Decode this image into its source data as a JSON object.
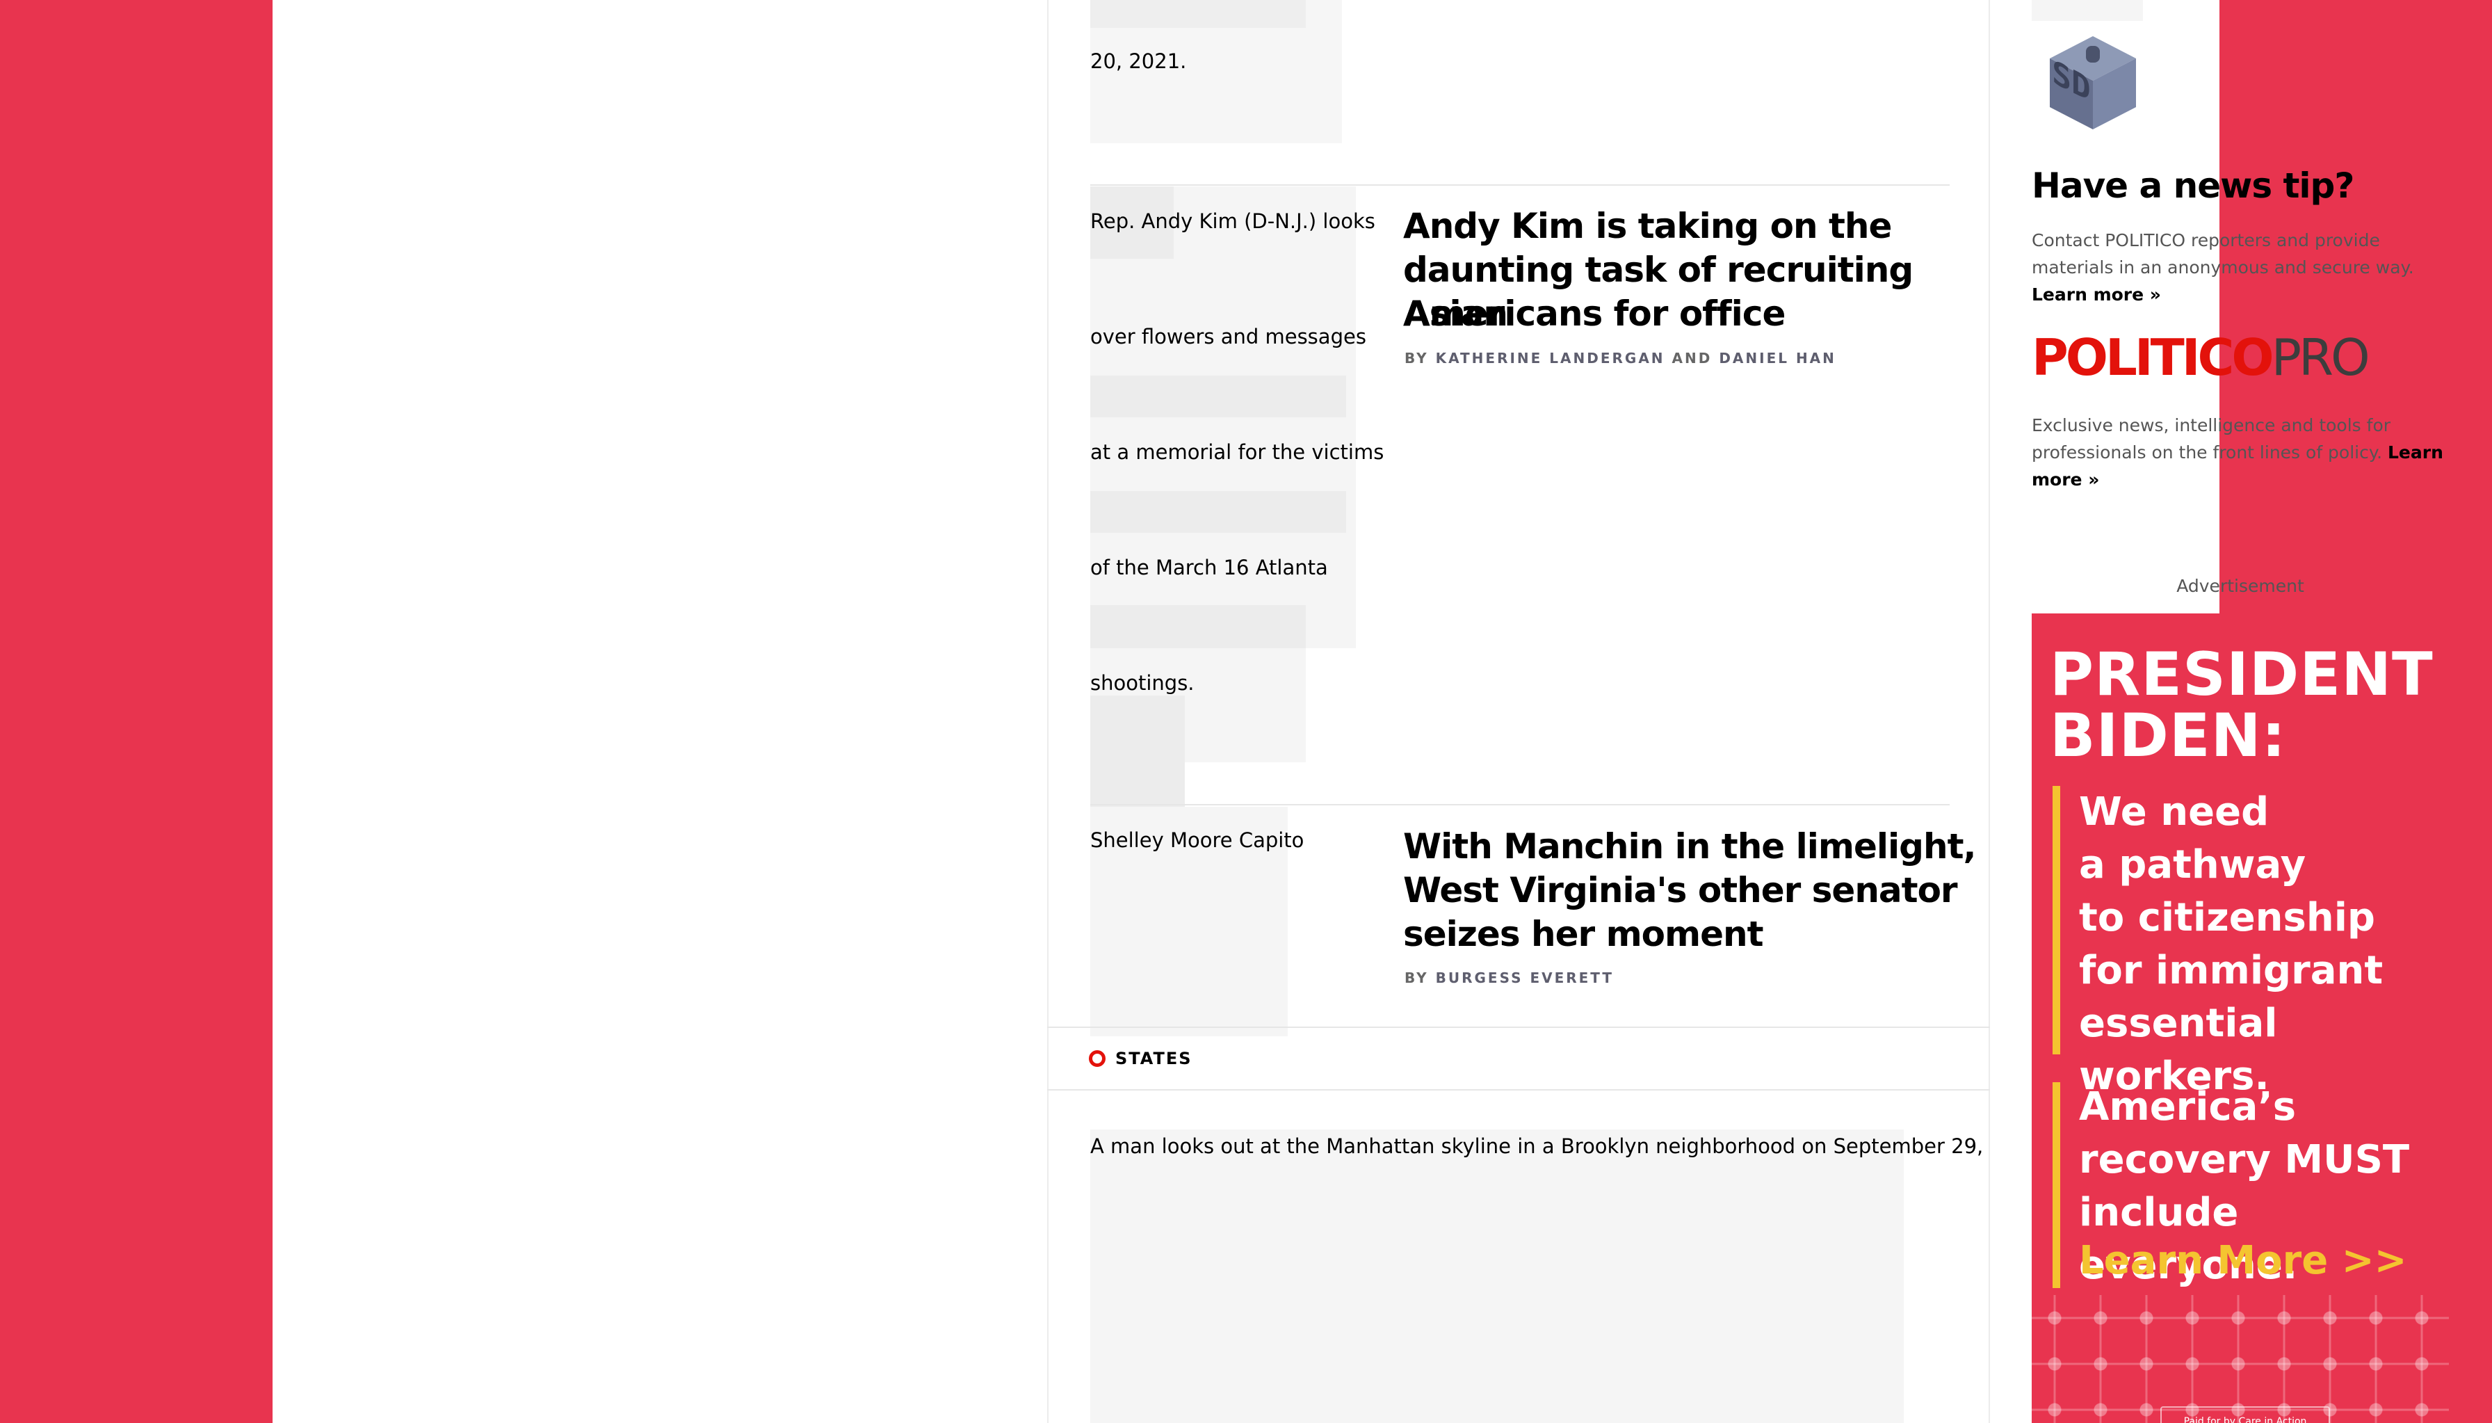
{
  "feed": {
    "top_caption": "20, 2021.",
    "articles": [
      {
        "image_caption": [
          "Rep. Andy Kim (D-N.J.) looks",
          "over flowers and messages",
          "at a memorial for the victims",
          "of the March 16 Atlanta",
          "shootings."
        ],
        "headline": [
          "Andy Kim is taking on the",
          "daunting task of recruiting Asian",
          "Americans for office"
        ],
        "byline_prefix": "BY",
        "authors": [
          "KATHERINE LANDERGAN",
          "DANIEL HAN"
        ],
        "author_joiner": "AND"
      },
      {
        "image_caption": [
          "Shelley Moore Capito"
        ],
        "headline": [
          "With Manchin in the limelight,",
          "West Virginia's other senator",
          "seizes her moment"
        ],
        "byline_prefix": "BY",
        "authors": [
          "BURGESS EVERETT"
        ]
      }
    ],
    "section_label": "STATES",
    "bottom_caption": "A man looks out at the Manhattan skyline in a Brooklyn neighborhood on September 29,"
  },
  "rail": {
    "logo_letters": "SD",
    "tip_title": "Have a news tip?",
    "tip_text": "Contact POLITICO reporters and provide materials in an anonymous and secure way.",
    "tip_link": "Learn more »",
    "pro_logo_part1": "POLITICO",
    "pro_logo_part2": "PRO",
    "pro_text": "Exclusive news, intelligence and tools for professionals on the front lines of policy.",
    "pro_link": "Learn more »",
    "ad_label": "Advertisement",
    "ad": {
      "headline": [
        "PRESIDENT",
        "BIDEN:"
      ],
      "copy1": [
        "We need",
        "a pathway",
        "to citizenship",
        "for immigrant",
        "essential workers."
      ],
      "copy2": [
        "America’s",
        "recovery MUST",
        "include everyone."
      ],
      "cta": "Learn More >>",
      "paid_by": "Paid for by Care in Action"
    }
  },
  "colors": {
    "page_background": "#e8344f",
    "accent_red": "#e3120b",
    "ad_yellow": "#f4c430"
  }
}
